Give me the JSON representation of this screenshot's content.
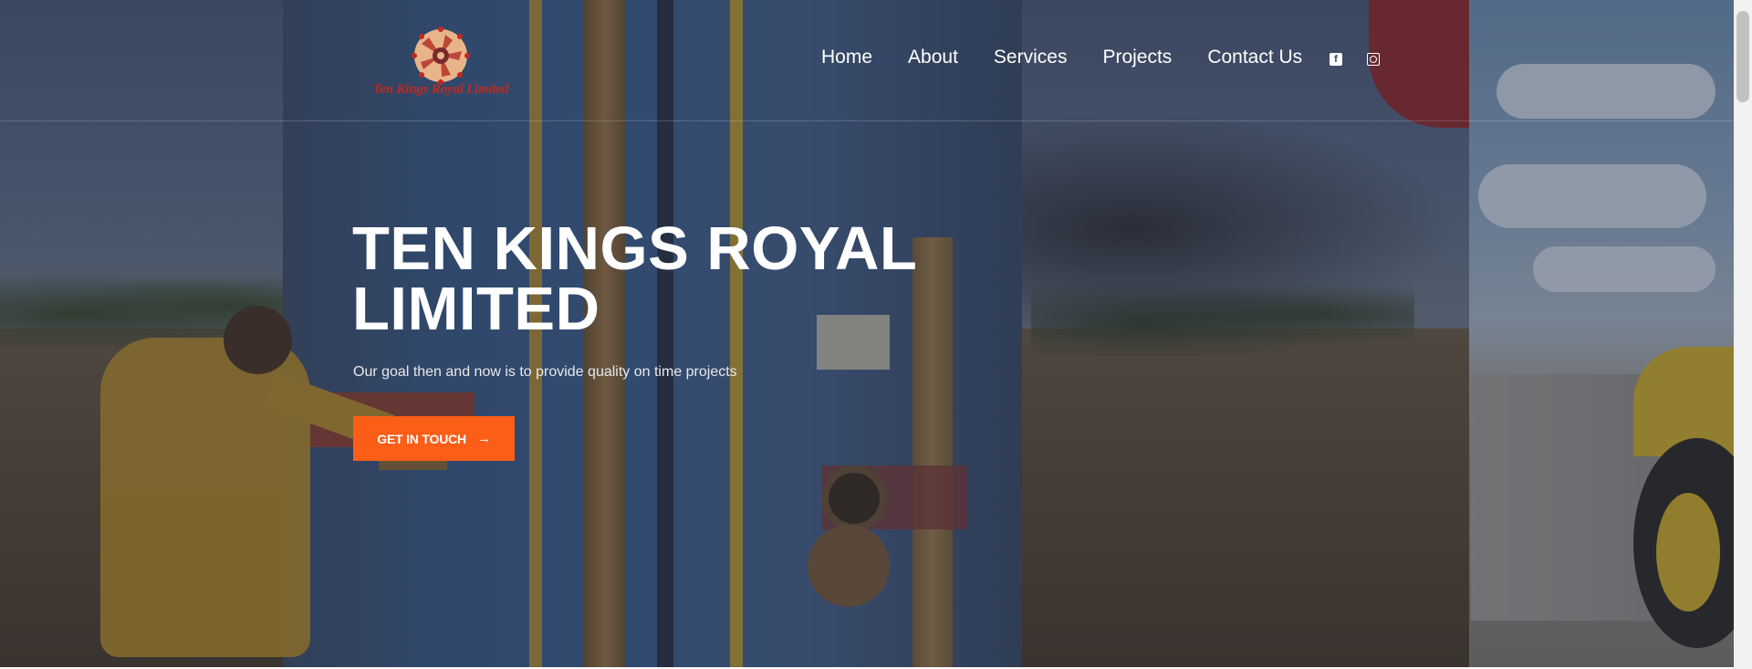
{
  "brand": {
    "logo_text": "Ten Kings Royal Limited",
    "logo_color": "#c4291d"
  },
  "nav": {
    "items": [
      "Home",
      "About",
      "Services",
      "Projects",
      "Contact Us"
    ],
    "social": [
      "facebook-icon",
      "instagram-icon"
    ]
  },
  "hero": {
    "title": "TEN KINGS ROYAL LIMITED",
    "subtitle": "Our goal then and now is to provide quality on time projects",
    "cta_label": "GET IN TOUCH",
    "cta_arrow": "→",
    "cta_color": "#fd5e17"
  }
}
